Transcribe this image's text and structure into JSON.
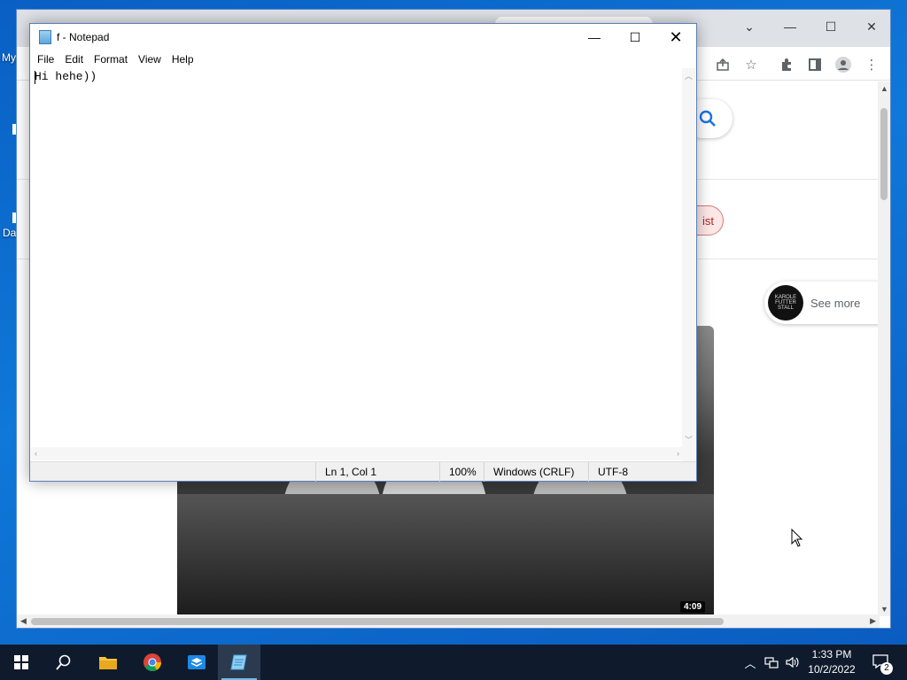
{
  "desktop": {
    "icon_labels": [
      "My",
      "Da"
    ]
  },
  "chrome": {
    "see_more_label": "See more",
    "avatar_text": "KAROLE FUTTER STALL",
    "chip_label": "ist",
    "video_duration": "4:09"
  },
  "notepad": {
    "title": "f - Notepad",
    "menu": [
      "File",
      "Edit",
      "Format",
      "View",
      "Help"
    ],
    "content": "Hi hehe))",
    "status": {
      "position": "Ln 1, Col 1",
      "zoom": "100%",
      "line_ending": "Windows (CRLF)",
      "encoding": "UTF-8"
    }
  },
  "taskbar": {
    "apps": [
      "start-icon",
      "search-icon",
      "file-explorer-icon",
      "chrome-icon",
      "sandbox-icon",
      "notepad-icon"
    ],
    "clock_time": "1:33 PM",
    "clock_date": "10/2/2022",
    "notification_count": "2"
  }
}
